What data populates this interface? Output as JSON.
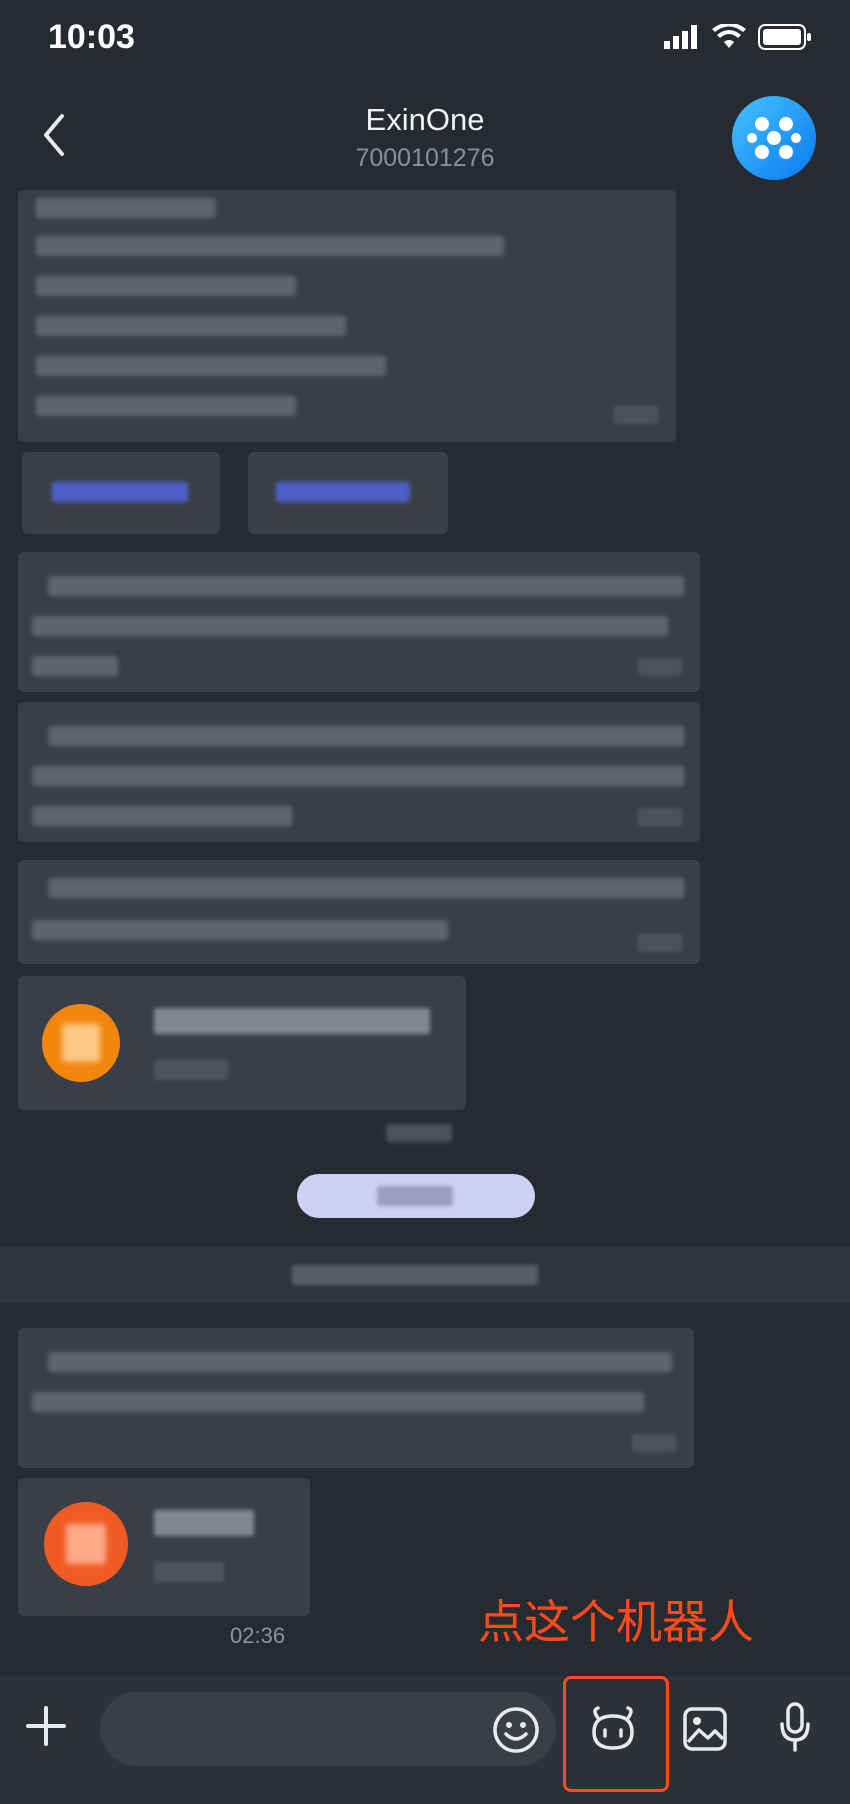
{
  "status_bar": {
    "time": "10:03"
  },
  "header": {
    "title": "ExinOne",
    "subtitle": "7000101276"
  },
  "messages": {
    "last_time": "02:36"
  },
  "annotation": {
    "text": "点这个机器人"
  },
  "composer": {
    "placeholder": ""
  },
  "colors": {
    "accent": "#ff4a1c",
    "avatar": "#1a8cff",
    "date_pill": "#cfd0f5"
  }
}
